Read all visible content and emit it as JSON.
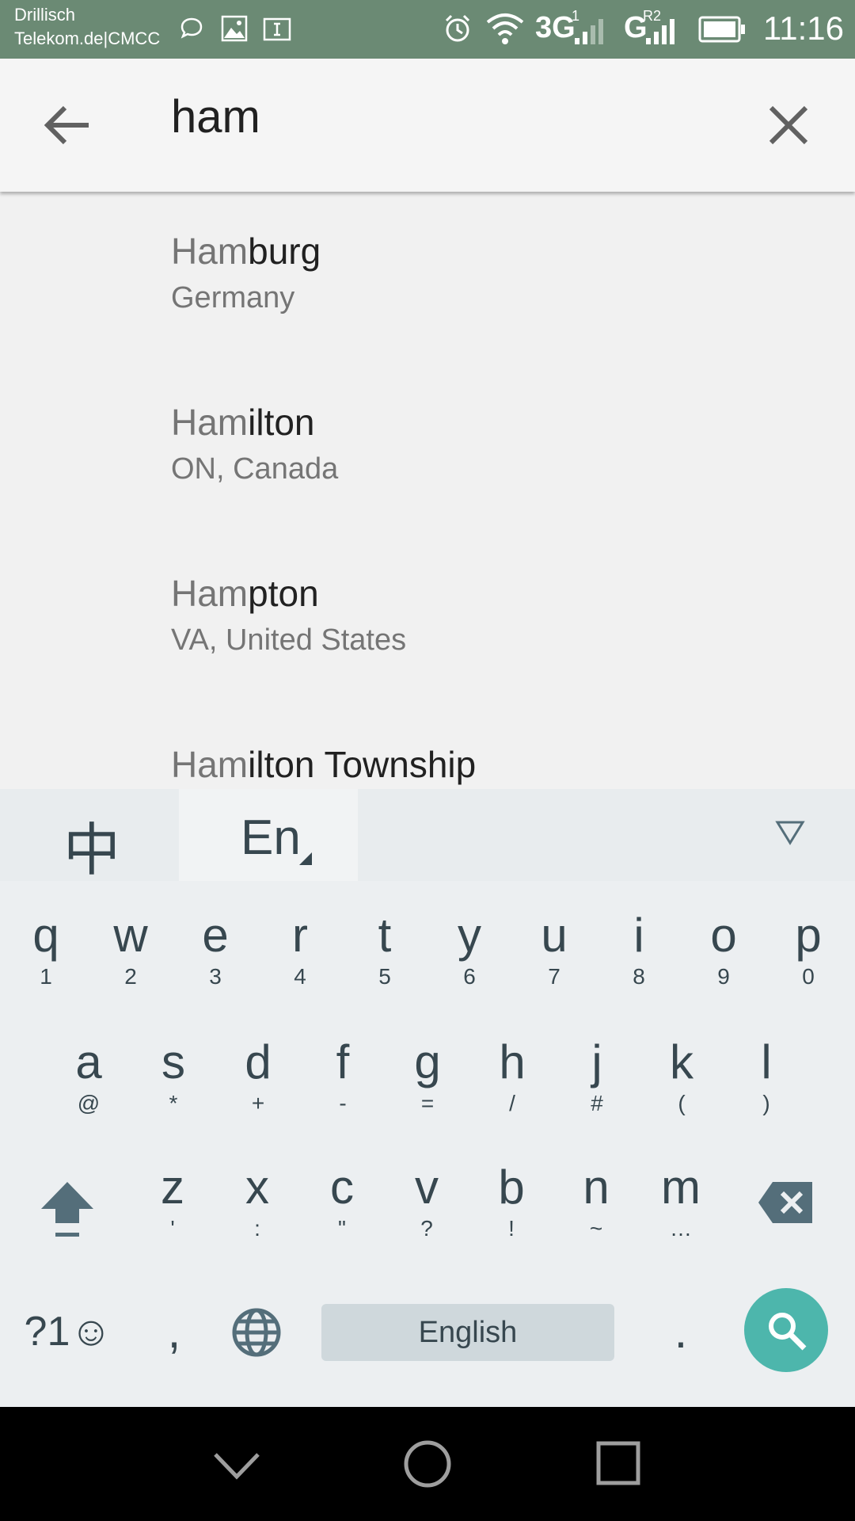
{
  "status_bar": {
    "carrier_line1": "Drillisch",
    "carrier_line2": "Telekom.de|CMCC",
    "network1": "3G",
    "network2": "G",
    "sim1": "1",
    "roaming": "R2",
    "time": "11:16"
  },
  "search": {
    "query": "ham"
  },
  "results": [
    {
      "match": "Ham",
      "rest": "burg",
      "subtitle": "Germany"
    },
    {
      "match": "Ham",
      "rest": "ilton",
      "subtitle": "ON, Canada"
    },
    {
      "match": "Ham",
      "rest": "pton",
      "subtitle": "VA, United States"
    },
    {
      "match": "Ham",
      "rest": "ilton Township",
      "subtitle": ""
    }
  ],
  "keyboard": {
    "lang_chinese": "中",
    "lang_english": "En",
    "row1": [
      {
        "key": "q",
        "sub": "1"
      },
      {
        "key": "w",
        "sub": "2"
      },
      {
        "key": "e",
        "sub": "3"
      },
      {
        "key": "r",
        "sub": "4"
      },
      {
        "key": "t",
        "sub": "5"
      },
      {
        "key": "y",
        "sub": "6"
      },
      {
        "key": "u",
        "sub": "7"
      },
      {
        "key": "i",
        "sub": "8"
      },
      {
        "key": "o",
        "sub": "9"
      },
      {
        "key": "p",
        "sub": "0"
      }
    ],
    "row2": [
      {
        "key": "a",
        "sub": "@"
      },
      {
        "key": "s",
        "sub": "*"
      },
      {
        "key": "d",
        "sub": "+"
      },
      {
        "key": "f",
        "sub": "-"
      },
      {
        "key": "g",
        "sub": "="
      },
      {
        "key": "h",
        "sub": "/"
      },
      {
        "key": "j",
        "sub": "#"
      },
      {
        "key": "k",
        "sub": "("
      },
      {
        "key": "l",
        "sub": ")"
      }
    ],
    "row3": [
      {
        "key": "z",
        "sub": "'"
      },
      {
        "key": "x",
        "sub": ":"
      },
      {
        "key": "c",
        "sub": "\""
      },
      {
        "key": "v",
        "sub": "?"
      },
      {
        "key": "b",
        "sub": "!"
      },
      {
        "key": "n",
        "sub": "~"
      },
      {
        "key": "m",
        "sub": "…"
      }
    ],
    "symbols_label": "?1☺",
    "comma": ",",
    "space_label": "English",
    "period": "."
  },
  "colors": {
    "status_bar": "#6b8a74",
    "search_key": "#4db6ac",
    "key_text": "#37474f"
  }
}
